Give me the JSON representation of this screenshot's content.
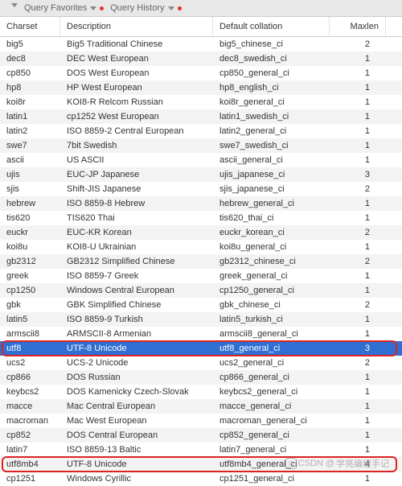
{
  "toolbar": {
    "favorites_label": "Query Favorites",
    "history_label": "Query History"
  },
  "columns": {
    "c1": "Charset",
    "c2": "Description",
    "c3": "Default collation",
    "c4": "Maxlen"
  },
  "rows": [
    {
      "charset": "big5",
      "desc": "Big5 Traditional Chinese",
      "coll": "big5_chinese_ci",
      "maxlen": "2"
    },
    {
      "charset": "dec8",
      "desc": "DEC West European",
      "coll": "dec8_swedish_ci",
      "maxlen": "1"
    },
    {
      "charset": "cp850",
      "desc": "DOS West European",
      "coll": "cp850_general_ci",
      "maxlen": "1"
    },
    {
      "charset": "hp8",
      "desc": "HP West European",
      "coll": "hp8_english_ci",
      "maxlen": "1"
    },
    {
      "charset": "koi8r",
      "desc": "KOI8-R Relcom Russian",
      "coll": "koi8r_general_ci",
      "maxlen": "1"
    },
    {
      "charset": "latin1",
      "desc": "cp1252 West European",
      "coll": "latin1_swedish_ci",
      "maxlen": "1"
    },
    {
      "charset": "latin2",
      "desc": "ISO 8859-2 Central European",
      "coll": "latin2_general_ci",
      "maxlen": "1"
    },
    {
      "charset": "swe7",
      "desc": "7bit Swedish",
      "coll": "swe7_swedish_ci",
      "maxlen": "1"
    },
    {
      "charset": "ascii",
      "desc": "US ASCII",
      "coll": "ascii_general_ci",
      "maxlen": "1"
    },
    {
      "charset": "ujis",
      "desc": "EUC-JP Japanese",
      "coll": "ujis_japanese_ci",
      "maxlen": "3"
    },
    {
      "charset": "sjis",
      "desc": "Shift-JIS Japanese",
      "coll": "sjis_japanese_ci",
      "maxlen": "2"
    },
    {
      "charset": "hebrew",
      "desc": "ISO 8859-8 Hebrew",
      "coll": "hebrew_general_ci",
      "maxlen": "1"
    },
    {
      "charset": "tis620",
      "desc": "TIS620 Thai",
      "coll": "tis620_thai_ci",
      "maxlen": "1"
    },
    {
      "charset": "euckr",
      "desc": "EUC-KR Korean",
      "coll": "euckr_korean_ci",
      "maxlen": "2"
    },
    {
      "charset": "koi8u",
      "desc": "KOI8-U Ukrainian",
      "coll": "koi8u_general_ci",
      "maxlen": "1"
    },
    {
      "charset": "gb2312",
      "desc": "GB2312 Simplified Chinese",
      "coll": "gb2312_chinese_ci",
      "maxlen": "2"
    },
    {
      "charset": "greek",
      "desc": "ISO 8859-7 Greek",
      "coll": "greek_general_ci",
      "maxlen": "1"
    },
    {
      "charset": "cp1250",
      "desc": "Windows Central European",
      "coll": "cp1250_general_ci",
      "maxlen": "1"
    },
    {
      "charset": "gbk",
      "desc": "GBK Simplified Chinese",
      "coll": "gbk_chinese_ci",
      "maxlen": "2"
    },
    {
      "charset": "latin5",
      "desc": "ISO 8859-9 Turkish",
      "coll": "latin5_turkish_ci",
      "maxlen": "1"
    },
    {
      "charset": "armscii8",
      "desc": "ARMSCII-8 Armenian",
      "coll": "armscii8_general_ci",
      "maxlen": "1"
    },
    {
      "charset": "utf8",
      "desc": "UTF-8 Unicode",
      "coll": "utf8_general_ci",
      "maxlen": "3",
      "selected": true,
      "boxed": true
    },
    {
      "charset": "ucs2",
      "desc": "UCS-2 Unicode",
      "coll": "ucs2_general_ci",
      "maxlen": "2"
    },
    {
      "charset": "cp866",
      "desc": "DOS Russian",
      "coll": "cp866_general_ci",
      "maxlen": "1"
    },
    {
      "charset": "keybcs2",
      "desc": "DOS Kamenicky Czech-Slovak",
      "coll": "keybcs2_general_ci",
      "maxlen": "1"
    },
    {
      "charset": "macce",
      "desc": "Mac Central European",
      "coll": "macce_general_ci",
      "maxlen": "1"
    },
    {
      "charset": "macroman",
      "desc": "Mac West European",
      "coll": "macroman_general_ci",
      "maxlen": "1"
    },
    {
      "charset": "cp852",
      "desc": "DOS Central European",
      "coll": "cp852_general_ci",
      "maxlen": "1"
    },
    {
      "charset": "latin7",
      "desc": "ISO 8859-13 Baltic",
      "coll": "latin7_general_ci",
      "maxlen": "1"
    },
    {
      "charset": "utf8mb4",
      "desc": "UTF-8 Unicode",
      "coll": "utf8mb4_general_ci",
      "maxlen": "4",
      "boxed": true
    },
    {
      "charset": "cp1251",
      "desc": "Windows Cyrillic",
      "coll": "cp1251_general_ci",
      "maxlen": "1"
    }
  ],
  "watermark": {
    "prefix": "CSDN @",
    "text": "学亮编程手记"
  }
}
